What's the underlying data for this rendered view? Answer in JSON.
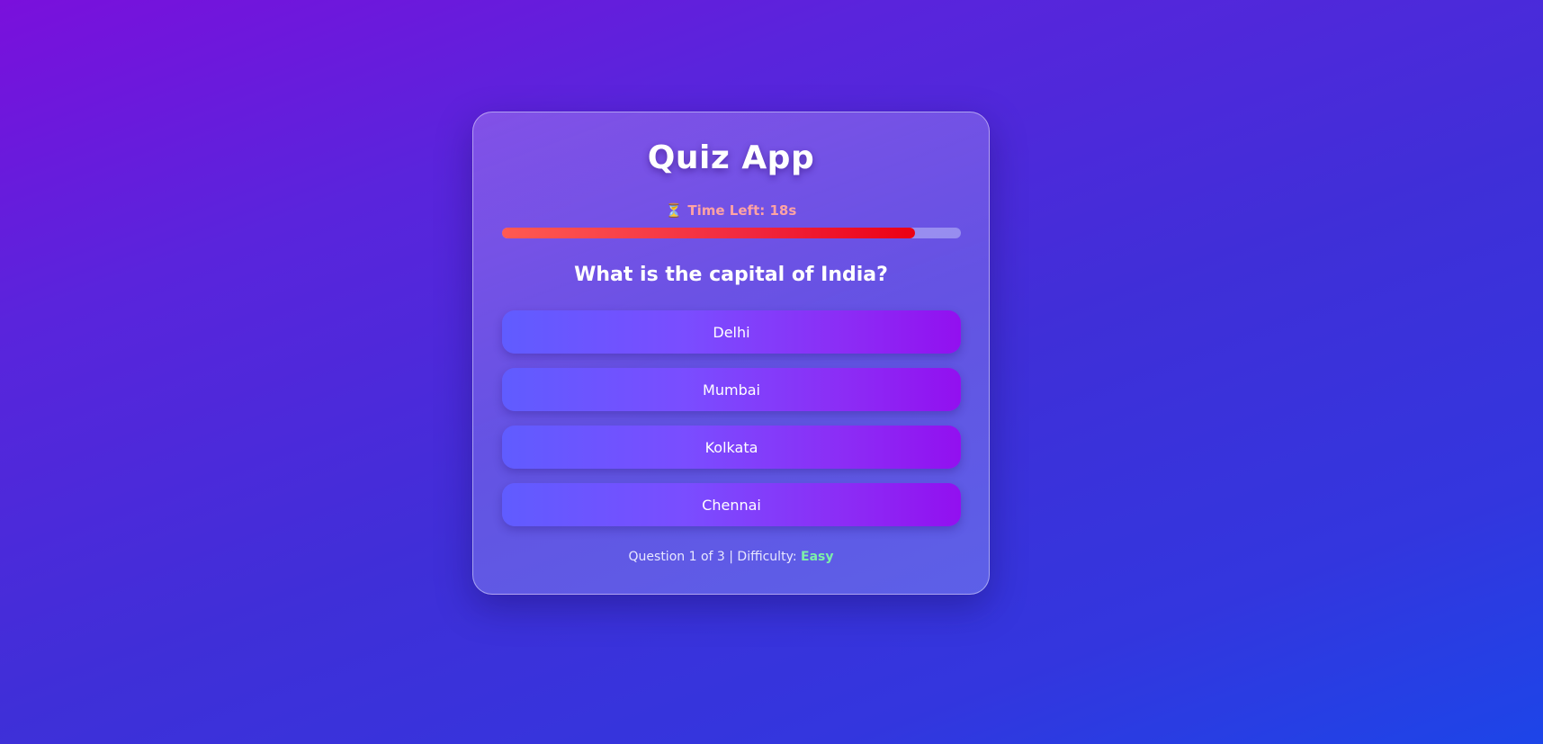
{
  "app": {
    "title": "Quiz App"
  },
  "timer": {
    "icon": "hourglass-icon",
    "text": "Time Left: 18s",
    "progress_fraction": 0.9
  },
  "question": {
    "text": "What is the capital of India?",
    "options": [
      "Delhi",
      "Mumbai",
      "Kolkata",
      "Chennai"
    ]
  },
  "footer": {
    "progress_text": "Question 1 of 3 | Difficulty: ",
    "difficulty": "Easy"
  },
  "colors": {
    "timer_text": "#ffa3a3",
    "difficulty_easy": "#7df0a8",
    "progress_fill": "#ec0014"
  }
}
